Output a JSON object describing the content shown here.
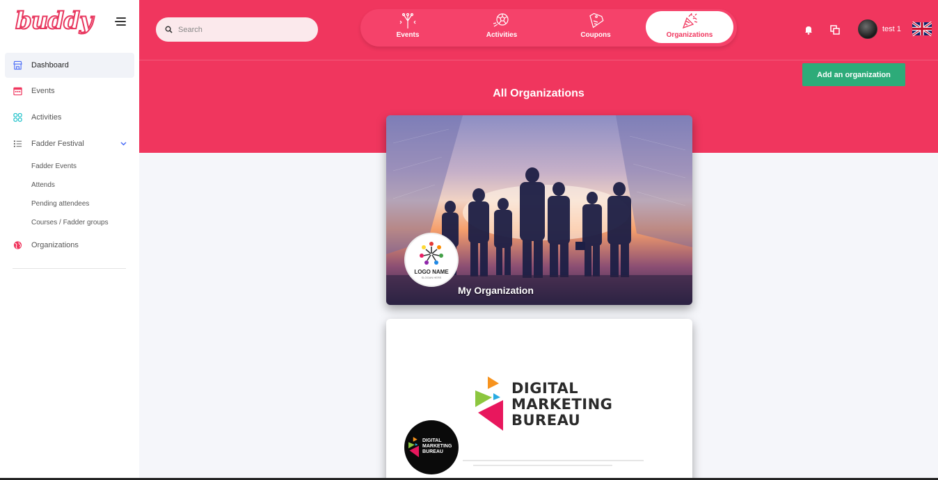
{
  "brand": {
    "logo_text": "buddy",
    "accent": "#f0365e"
  },
  "sidebar": {
    "items": [
      {
        "label": "Dashboard",
        "icon": "store-icon",
        "active": true
      },
      {
        "label": "Events",
        "icon": "calendar-icon"
      },
      {
        "label": "Activities",
        "icon": "grid-icon"
      },
      {
        "label": "Fadder Festival",
        "icon": "list-icon",
        "expanded": true,
        "children": [
          "Fadder Events",
          "Attends",
          "Pending attendees",
          "Courses / Fadder groups"
        ]
      },
      {
        "label": "Organizations",
        "icon": "globe-icon"
      }
    ]
  },
  "header": {
    "search_placeholder": "Search",
    "tabs": [
      {
        "label": "Events",
        "icon": "fireworks-icon"
      },
      {
        "label": "Activities",
        "icon": "ball-icon"
      },
      {
        "label": "Coupons",
        "icon": "coupon-icon"
      },
      {
        "label": "Organizations",
        "icon": "party-popper-icon",
        "active": true
      }
    ],
    "username": "test 1",
    "language": "en-GB"
  },
  "main": {
    "title": "All Organizations",
    "add_button": "Add an organization",
    "cards": [
      {
        "name": "My Organization",
        "logo_text": "LOGO NAME",
        "logo_subtext": "SLOGAN HERE"
      },
      {
        "name": "",
        "banner_text": [
          "DIGITAL",
          "MARKETING",
          "BUREAU"
        ]
      }
    ]
  }
}
